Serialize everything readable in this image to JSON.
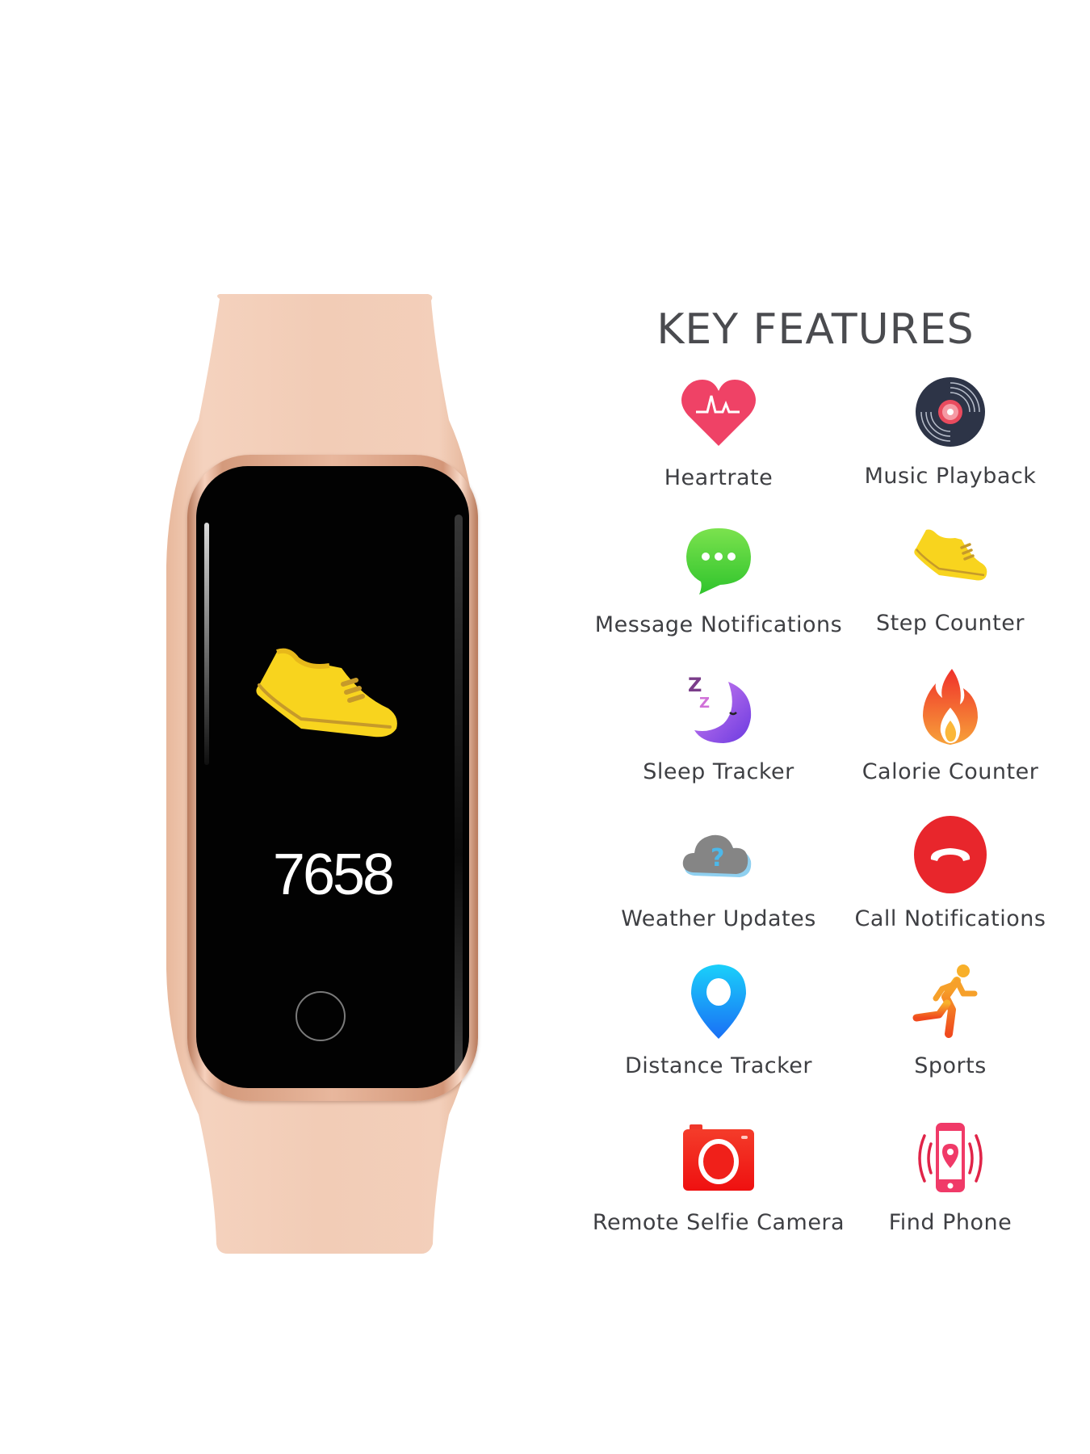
{
  "product": {
    "type": "fitness-band",
    "band_color": "#f1cbb4",
    "bezel_color": "#d49a7c",
    "screen": {
      "activity_icon": "shoe-icon",
      "step_count": "7658"
    }
  },
  "features": {
    "title": "KEY FEATURES",
    "items": [
      {
        "label": "Heartrate",
        "icon": "heart-rate-icon",
        "color": "#ef4266"
      },
      {
        "label": "Music Playback",
        "icon": "vinyl-record-icon",
        "color": "#2d3447"
      },
      {
        "label": "Message Notifications",
        "icon": "chat-bubble-icon",
        "color": "#4cd43a"
      },
      {
        "label": "Step Counter",
        "icon": "shoe-icon",
        "color": "#f7d21e"
      },
      {
        "label": "Sleep Tracker",
        "icon": "sleeping-moon-icon",
        "color": "#9b4fe6"
      },
      {
        "label": "Calorie Counter",
        "icon": "flame-icon",
        "color": "#f25a26"
      },
      {
        "label": "Weather Updates",
        "icon": "cloud-question-icon",
        "color": "#858585"
      },
      {
        "label": "Call Notifications",
        "icon": "phone-hangup-icon",
        "color": "#e8262c"
      },
      {
        "label": "Distance Tracker",
        "icon": "location-pin-icon",
        "color": "#1aa3f5"
      },
      {
        "label": "Sports",
        "icon": "running-person-icon",
        "color": "#f6901e"
      },
      {
        "label": "Remote Selfie Camera",
        "icon": "camera-icon",
        "color": "#f01c1c"
      },
      {
        "label": "Find Phone",
        "icon": "find-phone-icon",
        "color": "#f03a68"
      }
    ]
  }
}
